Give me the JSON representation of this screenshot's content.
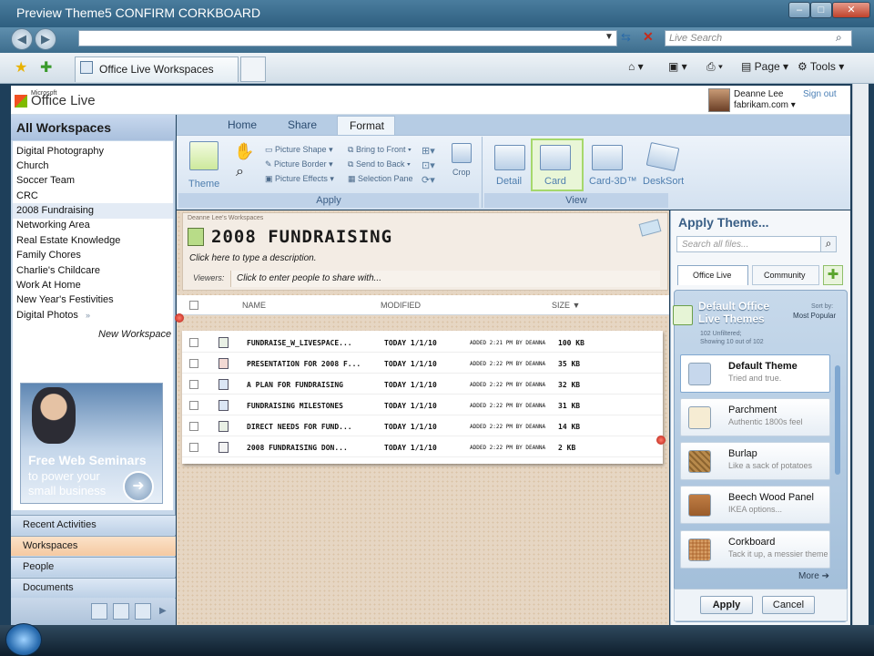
{
  "window": {
    "title": "Preview Theme5 CONFIRM CORKBOARD"
  },
  "browser": {
    "search_placeholder": "Live Search",
    "tab_label": "Office Live Workspaces",
    "commands": {
      "page": "Page",
      "tools": "Tools"
    }
  },
  "header": {
    "logo_small": "Microsoft",
    "logo": "Office Live",
    "user_name": "Deanne Lee",
    "user_domain": "fabrikam.com",
    "sign_out": "Sign out"
  },
  "sidebar": {
    "title": "All Workspaces",
    "workspaces": [
      "Digital Photography",
      "Church",
      "Soccer Team",
      "CRC",
      "2008 Fundraising",
      "Networking Area",
      "Real Estate Knowledge",
      "Family Chores",
      "Charlie's Childcare",
      "Work At Home",
      "New Year's Festivities",
      "Digital Photos"
    ],
    "new_workspace": "New Workspace",
    "ad": {
      "line1": "Free Web Seminars",
      "line2": "to power your",
      "line3": "small business"
    },
    "nav": [
      "Recent Activities",
      "Workspaces",
      "People",
      "Documents"
    ]
  },
  "ribbon": {
    "tabs": [
      "Home",
      "Share",
      "Format"
    ],
    "active_tab": "Format",
    "theme_label": "Theme",
    "picture_shape": "Picture Shape",
    "picture_border": "Picture Border",
    "picture_effects": "Picture Effects",
    "bring_to_front": "Bring to Front",
    "send_to_back": "Send to Back",
    "selection_pane": "Selection Pane",
    "crop": "Crop",
    "apply_group": "Apply",
    "view_group": "View",
    "views": [
      "Detail",
      "Card",
      "Card-3D™",
      "DeskSort"
    ]
  },
  "workspace": {
    "breadcrumb": "Deanne Lee's Workspaces",
    "title": "2008 FUNDRAISING",
    "description": "Click here to type a description.",
    "viewers_label": "Viewers:",
    "viewers_placeholder": "Click to enter people to share with...",
    "columns": {
      "name": "NAME",
      "modified": "MODIFIED",
      "size": "SIZE"
    },
    "files": [
      {
        "name": "FUNDRAISE_W_LIVESPACE...",
        "modified": "TODAY 1/1/10",
        "by": "ADDED 2:21 PM BY DEANNA",
        "size": "100 KB"
      },
      {
        "name": "PRESENTATION FOR 2008 F...",
        "modified": "TODAY 1/1/10",
        "by": "ADDED 2:22 PM BY DEANNA",
        "size": "35 KB"
      },
      {
        "name": "A PLAN FOR FUNDRAISING",
        "modified": "TODAY 1/1/10",
        "by": "ADDED 2:22 PM BY DEANNA",
        "size": "32 KB"
      },
      {
        "name": "FUNDRAISING MILESTONES",
        "modified": "TODAY 1/1/10",
        "by": "ADDED 2:22 PM BY DEANNA",
        "size": "31 KB"
      },
      {
        "name": "DIRECT NEEDS FOR FUND...",
        "modified": "TODAY 1/1/10",
        "by": "ADDED 2:22 PM BY DEANNA",
        "size": "14 KB"
      },
      {
        "name": "2008 FUNDRAISING DON...",
        "modified": "TODAY 1/1/10",
        "by": "ADDED 2:22 PM BY DEANNA",
        "size": "2 KB"
      }
    ]
  },
  "theme_panel": {
    "title": "Apply Theme...",
    "search_placeholder": "Search all files...",
    "tab_officelive": "Office Live",
    "tab_community": "Community",
    "group_title": "Default Office Live Themes",
    "sort_label": "Sort by:",
    "sort_value": "Most Popular",
    "count1": "102 Unfiltered;",
    "count2": "Showing 10 out of 102",
    "themes": [
      {
        "name": "Default Theme",
        "desc": "Tried and true.",
        "color": "#c6d7ec"
      },
      {
        "name": "Parchment",
        "desc": "Authentic 1800s feel",
        "color": "#f6ecd3"
      },
      {
        "name": "Burlap",
        "desc": "Like a sack of potatoes",
        "color": "#b88a4c"
      },
      {
        "name": "Beech Wood Panel",
        "desc": "IKEA options...",
        "color": "#b8743e"
      },
      {
        "name": "Corkboard",
        "desc": "Tack it up, a messier theme",
        "color": "#c88a52"
      }
    ],
    "more": "More",
    "apply": "Apply",
    "cancel": "Cancel"
  }
}
